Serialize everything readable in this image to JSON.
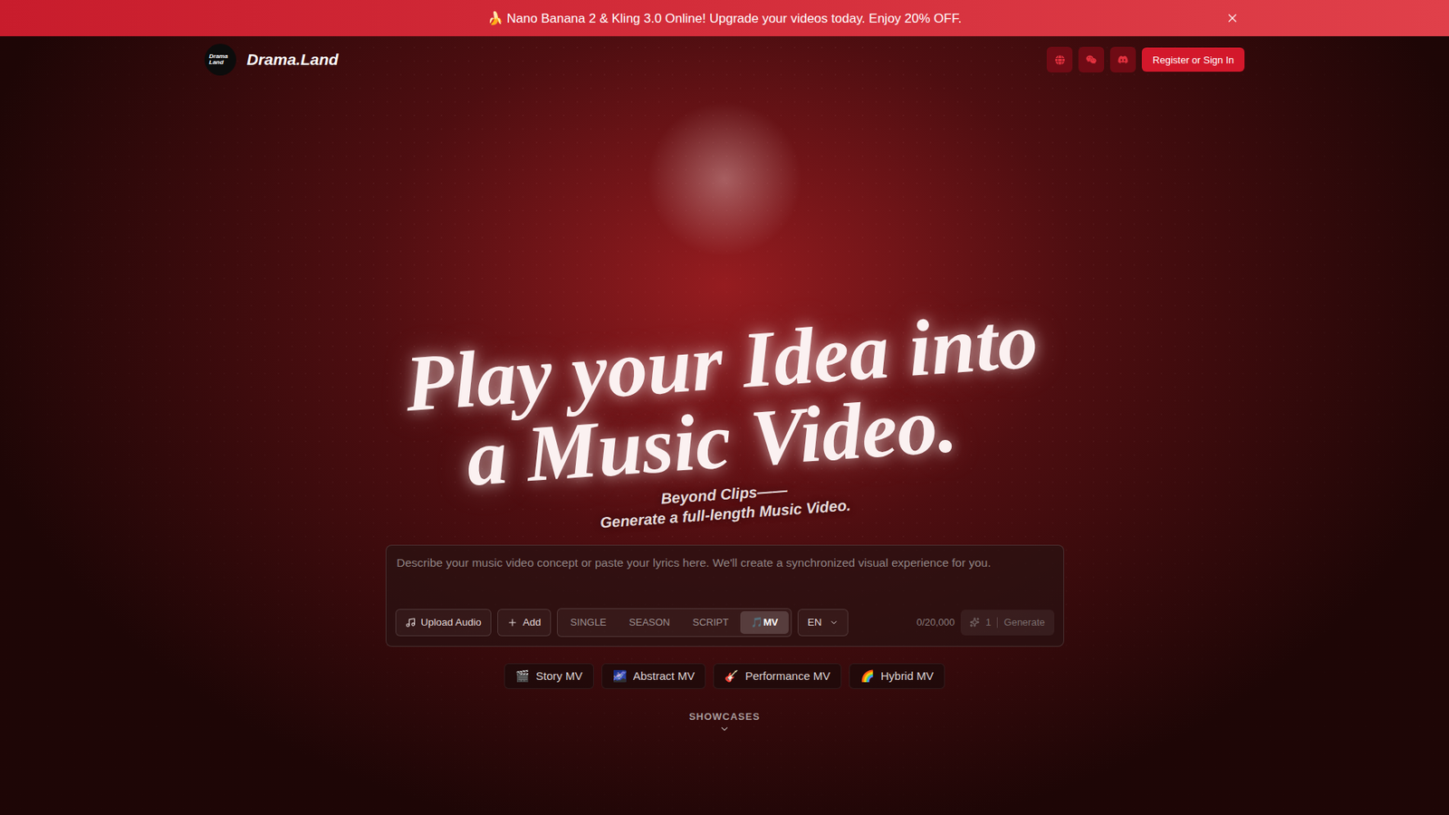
{
  "banner": {
    "text": "🍌 Nano Banana 2 & Kling 3.0 Online! Upgrade your videos today. Enjoy 20% OFF."
  },
  "header": {
    "logo_lines": [
      "Drama",
      "Land"
    ],
    "brand": "Drama.Land",
    "sign_in": "Register or Sign In"
  },
  "hero": {
    "title_lines": [
      "Play your Idea into",
      "a Music Video."
    ],
    "subtitle_lines": [
      "Beyond Clips——",
      "Generate a full-length Music Video."
    ]
  },
  "composer": {
    "placeholder": "Describe your music video concept or paste your lyrics here. We'll create a synchronized visual experience for you.",
    "upload": "Upload Audio",
    "add": "Add",
    "modes": [
      {
        "icon": "",
        "label": "SINGLE",
        "selected": false
      },
      {
        "icon": "",
        "label": "SEASON",
        "selected": false
      },
      {
        "icon": "",
        "label": "SCRIPT",
        "selected": false
      },
      {
        "icon": "🎵",
        "label": "MV",
        "selected": true
      }
    ],
    "language": "EN",
    "counter": "0/20,000",
    "credits": "1",
    "generate": "Generate",
    "generate_disabled": true
  },
  "styles": [
    {
      "icon": "🎬",
      "label": "Story MV"
    },
    {
      "icon": "🌌",
      "label": "Abstract MV"
    },
    {
      "icon": "🎸",
      "label": "Performance MV"
    },
    {
      "icon": "🌈",
      "label": "Hybrid MV"
    }
  ],
  "showcases": {
    "label": "SHOWCASES"
  }
}
